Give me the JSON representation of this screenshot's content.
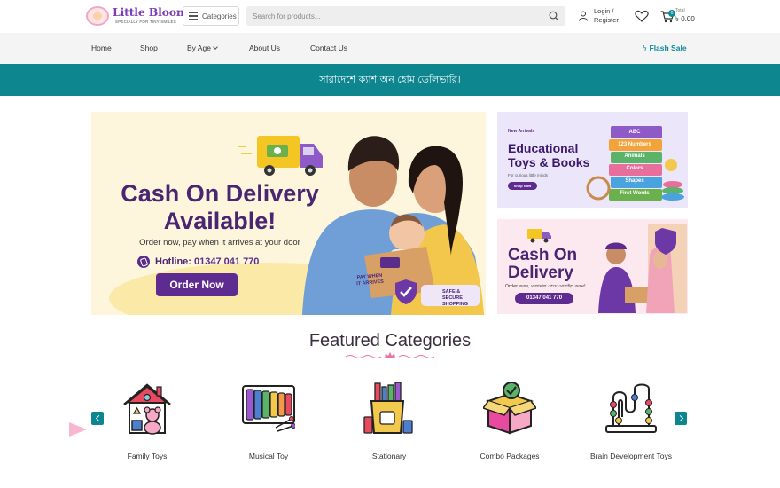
{
  "brand": {
    "name": "Little Bloom",
    "tagline": "SPECIALLY FOR TINY SMILES"
  },
  "header": {
    "categories_label": "Categories",
    "search_placeholder": "Search for products...",
    "login_line1": "Login /",
    "login_line2": "Register",
    "cart_count": "0",
    "cart_label": "Total",
    "cart_total": "৳ 0.00"
  },
  "nav": {
    "items": [
      "Home",
      "Shop",
      "By Age",
      "About Us",
      "Contact Us"
    ],
    "flash_sale": "Flash Sale"
  },
  "announcement": "সারাদেশে ক্যাশ অন হোম ডেলিভারি।",
  "hero": {
    "title_line1": "Cash On Delivery",
    "title_line2": "Available!",
    "subtitle": "Order now, pay when it arrives at your door",
    "hotline_label": "Hotline:",
    "hotline_number": "01347 041 770",
    "cta": "Order Now",
    "box_text_1": "PAY WHEN",
    "box_text_2": "IT ARRIVES",
    "badge_1": "SAFE & SECURE",
    "badge_2": "SHOPPING"
  },
  "side_banner_1": {
    "kicker": "New Arrivals",
    "title_1": "Educational",
    "title_2": "Toys & Books",
    "caption": "For curious little minds",
    "cta": "Shop Now",
    "blocks": [
      "ABC",
      "123 Numbers",
      "Animals",
      "Colors",
      "Shapes",
      "First Words"
    ]
  },
  "side_banner_2": {
    "title_1": "Cash On",
    "title_2": "Delivery",
    "bn_line": "Order করুন, মালামাল পেয়ে মোবাইল করুন!",
    "phone": "01347 041 770"
  },
  "featured": {
    "title": "Featured Categories",
    "categories": [
      {
        "label": "Family Toys",
        "icon": "house-toys-icon"
      },
      {
        "label": "Musical Toy",
        "icon": "xylophone-icon"
      },
      {
        "label": "Stationary",
        "icon": "pencil-cup-icon"
      },
      {
        "label": "Combo Packages",
        "icon": "gift-box-icon"
      },
      {
        "label": "Brain Development Toys",
        "icon": "bead-maze-icon"
      }
    ]
  },
  "colors": {
    "teal": "#0d8690",
    "purple": "#5e2b90",
    "pink": "#f7b7d2"
  }
}
